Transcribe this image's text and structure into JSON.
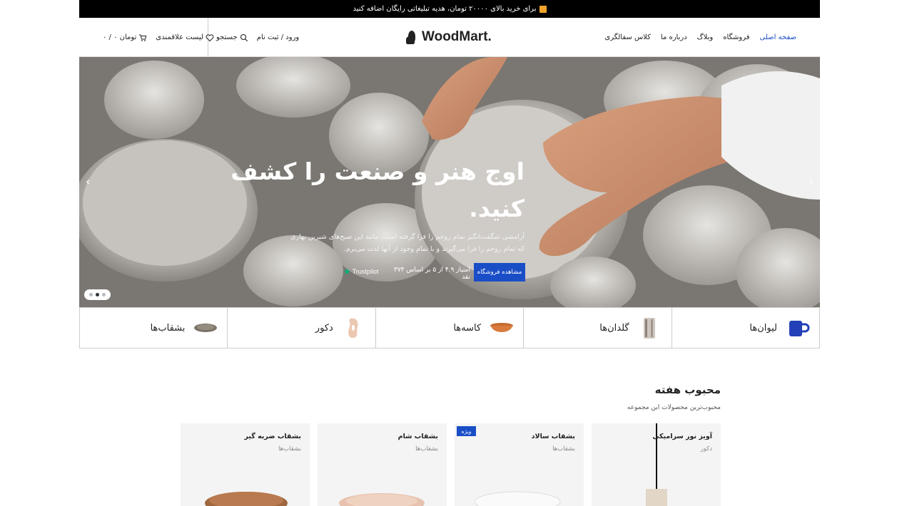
{
  "topbar": {
    "promo": "برای خرید بالای ۲۰۰۰۰ تومان، هدیه تبلیغاتی رایگان اضافه کنید"
  },
  "nav": {
    "home": "صفحه اصلی",
    "shop": "فروشگاه",
    "blog": "وبلاگ",
    "about": "درباره ما",
    "pottery_class": "کلاس سفالگری"
  },
  "logo": {
    "text": "WoodMart."
  },
  "tools": {
    "login": "ورود / ثبت نام",
    "search": "جستجو",
    "wishlist": "لیست علاقمندی",
    "cart": "۰ / ۰ تومان"
  },
  "hero": {
    "title": "اوج هنر و صنعت را کشف کنید.",
    "description": "آرامشی شگفت‌انگیز تمام روحم را فرا گرفته است، مانند این صبح‌های شیرین بهاری که تمام روحم را فرا می‌گیرند و با تمام وجود از آنها لذت می‌برم.",
    "cta": "مشاهده فروشگاه",
    "rating": "امتیاز ۴.۹ از ۵ بر اساس ۳۷۴ نقد",
    "trustpilot": "Trustpilot",
    "prev_arrow": "‹",
    "next_arrow": "›"
  },
  "categories": [
    {
      "label": "لیوان‌ها",
      "icon": "mug-icon"
    },
    {
      "label": "گلدان‌ها",
      "icon": "vase-icon"
    },
    {
      "label": "کاسه‌ها",
      "icon": "bowl-icon"
    },
    {
      "label": "دکور",
      "icon": "decor-icon"
    },
    {
      "label": "بشقاب‌ها",
      "icon": "plate-icon"
    }
  ],
  "section": {
    "title": "محبوب هفته",
    "subtitle": "محبوب‌ترین محصولات این مجموعه"
  },
  "products": [
    {
      "name": "آویز نور سرامیکی",
      "category": "دکور",
      "badge": ""
    },
    {
      "name": "بشقاب سالاد",
      "category": "بشقاب‌ها",
      "badge": "ویژه"
    },
    {
      "name": "بشقاب شام",
      "category": "بشقاب‌ها",
      "badge": ""
    },
    {
      "name": "بشقاب ضربه گیر",
      "category": "بشقاب‌ها",
      "badge": ""
    }
  ],
  "colors": {
    "accent": "#1a4ec7",
    "topbar": "#000000",
    "trustpilot": "#00b67a"
  }
}
